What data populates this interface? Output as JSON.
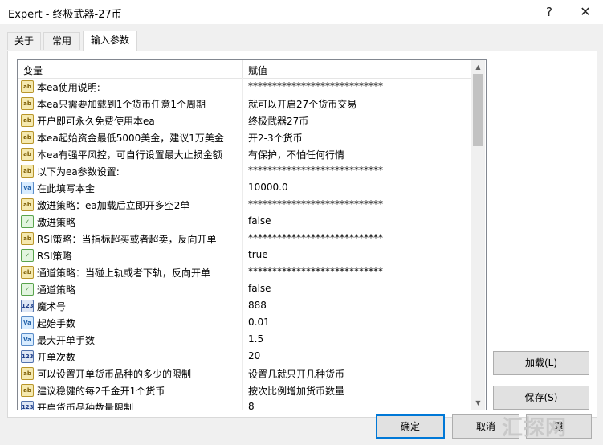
{
  "window": {
    "title": "Expert - 终极武器-27币",
    "help_label": "?",
    "close_label": "✕"
  },
  "tabs": [
    {
      "label": "关于"
    },
    {
      "label": "常用"
    },
    {
      "label": "输入参数"
    }
  ],
  "grid": {
    "columns": {
      "name": "变量",
      "value": "赋值"
    },
    "rows": [
      {
        "type": "str",
        "name": "本ea使用说明:",
        "value": "****************************"
      },
      {
        "type": "str",
        "name": "本ea只需要加载到1个货币任意1个周期",
        "value": "就可以开启27个货币交易"
      },
      {
        "type": "str",
        "name": "开户即可永久免费使用本ea",
        "value": "终极武器27币"
      },
      {
        "type": "str",
        "name": "本ea起始资金最低5000美金，建议1万美金",
        "value": "开2-3个货币"
      },
      {
        "type": "str",
        "name": "本ea有强平风控，可自行设置最大止损金额",
        "value": "有保护，不怕任何行情"
      },
      {
        "type": "str",
        "name": "以下为ea参数设置:",
        "value": "****************************"
      },
      {
        "type": "dbl",
        "name": "在此填写本金",
        "value": "10000.0"
      },
      {
        "type": "str",
        "name": "激进策略：ea加载后立即开多空2单",
        "value": "****************************"
      },
      {
        "type": "bool",
        "name": "激进策略",
        "value": "false"
      },
      {
        "type": "str",
        "name": "RSI策略：当指标超买或者超卖，反向开单",
        "value": "****************************"
      },
      {
        "type": "bool",
        "name": "RSI策略",
        "value": "true"
      },
      {
        "type": "str",
        "name": "通道策略：当碰上轨或者下轨，反向开单",
        "value": "****************************"
      },
      {
        "type": "bool",
        "name": "通道策略",
        "value": "false"
      },
      {
        "type": "int",
        "name": "魔术号",
        "value": "888"
      },
      {
        "type": "dbl",
        "name": "起始手数",
        "value": "0.01"
      },
      {
        "type": "dbl",
        "name": "最大开单手数",
        "value": "1.5"
      },
      {
        "type": "int",
        "name": "开单次数",
        "value": "20"
      },
      {
        "type": "str",
        "name": "可以设置开单货币品种的多少的限制",
        "value": "设置几就只开几种货币"
      },
      {
        "type": "str",
        "name": "建议稳健的每2千金开1个货币",
        "value": "按次比例增加货币数量"
      },
      {
        "type": "int",
        "name": "开启货币品种数量限制",
        "value": "8"
      }
    ],
    "icons": {
      "str": "ab",
      "dbl": "Va",
      "bool": "✓",
      "int": "123"
    }
  },
  "buttons": {
    "load": "加载(L)",
    "save": "保存(S)",
    "ok": "确定",
    "cancel": "取消",
    "reset": "重"
  },
  "watermark": "汇探网"
}
